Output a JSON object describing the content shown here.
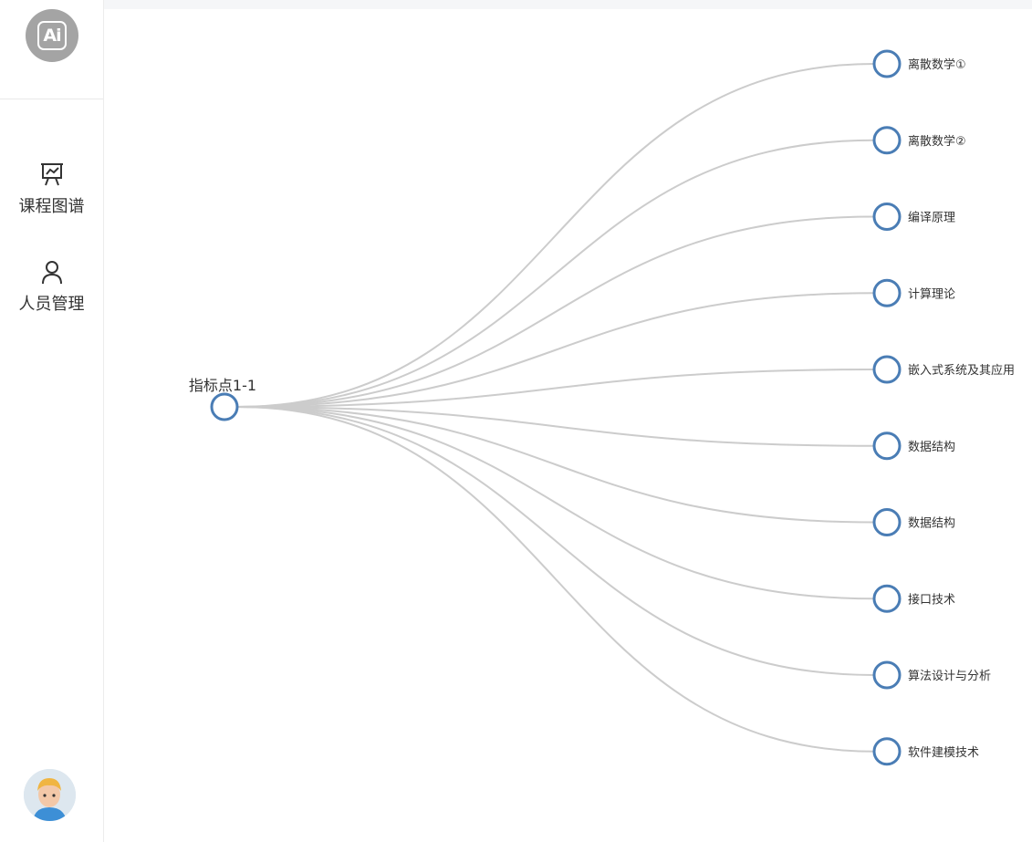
{
  "sidebar": {
    "logo_text": "Ai",
    "items": [
      {
        "label": "课程图谱",
        "icon": "presentation-chart-icon"
      },
      {
        "label": "人员管理",
        "icon": "user-icon"
      }
    ],
    "avatar": "user-avatar"
  },
  "graph": {
    "root": {
      "label": "指标点1-1"
    },
    "children": [
      {
        "label": "离散数学①"
      },
      {
        "label": "离散数学②"
      },
      {
        "label": "编译原理"
      },
      {
        "label": "计算理论"
      },
      {
        "label": "嵌入式系统及其应用"
      },
      {
        "label": "数据结构"
      },
      {
        "label": "数据结构"
      },
      {
        "label": "接口技术"
      },
      {
        "label": "算法设计与分析"
      },
      {
        "label": "软件建模技术"
      }
    ],
    "colors": {
      "node_stroke": "#4a7db5",
      "edge": "#cccccc"
    }
  }
}
